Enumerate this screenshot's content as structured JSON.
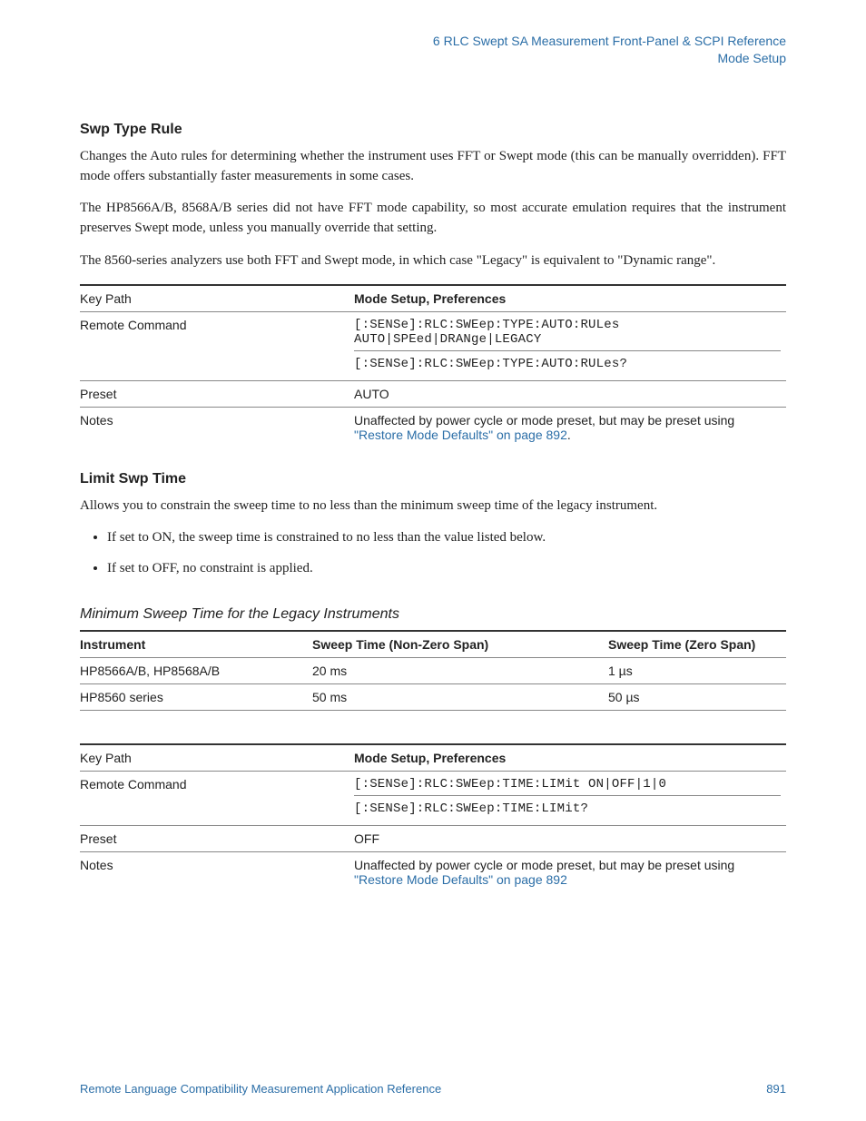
{
  "header": {
    "line1": "6  RLC Swept SA Measurement Front-Panel & SCPI Reference",
    "line2": "Mode Setup"
  },
  "sections": {
    "swpTypeRule": {
      "title": "Swp Type Rule",
      "p1": "Changes the Auto rules for determining whether the instrument uses FFT or Swept mode (this can be manually overridden). FFT mode offers substantially faster measurements in some cases.",
      "p2": "The HP8566A/B, 8568A/B series did not have FFT mode capability, so most accurate emulation requires that the instrument preserves Swept mode, unless you manually override that setting.",
      "p3": "The 8560-series analyzers use both FFT and Swept mode, in which case \"Legacy\" is equivalent to \"Dynamic range\".",
      "table": {
        "keyPath": {
          "label": "Key Path",
          "value": "Mode Setup, Preferences"
        },
        "remoteCommand": {
          "label": "Remote Command",
          "cmd1": "[:SENSe]:RLC:SWEep:TYPE:AUTO:RULes AUTO|SPEed|DRANge|LEGACY",
          "cmd2": "[:SENSe]:RLC:SWEep:TYPE:AUTO:RULes?"
        },
        "preset": {
          "label": "Preset",
          "value": "AUTO"
        },
        "notes": {
          "label": "Notes",
          "prefix": "Unaffected by power cycle or mode preset, but may be preset using ",
          "link": "\"Restore Mode Defaults\" on page 892",
          "suffix": "."
        }
      }
    },
    "limitSwpTime": {
      "title": "Limit Swp Time",
      "p1": "Allows you to constrain the sweep time to no less than the minimum sweep time of the legacy instrument.",
      "li1": "If set to ON, the sweep time is constrained to no less than the value listed below.",
      "li2": "If set to OFF, no constraint is applied.",
      "subhead": "Minimum Sweep Time for the Legacy Instruments",
      "dataTable": {
        "headers": {
          "c1": "Instrument",
          "c2": "Sweep Time (Non-Zero Span)",
          "c3": "Sweep Time (Zero Span)"
        },
        "rows": [
          {
            "c1": "HP8566A/B, HP8568A/B",
            "c2": "20 ms",
            "c3": "1 µs"
          },
          {
            "c1": "HP8560 series",
            "c2": "50 ms",
            "c3": "50 µs"
          }
        ]
      },
      "table": {
        "keyPath": {
          "label": "Key Path",
          "value": "Mode Setup, Preferences"
        },
        "remoteCommand": {
          "label": "Remote Command",
          "cmd1": "[:SENSe]:RLC:SWEep:TIME:LIMit ON|OFF|1|0",
          "cmd2": "[:SENSe]:RLC:SWEep:TIME:LIMit?"
        },
        "preset": {
          "label": "Preset",
          "value": "OFF"
        },
        "notes": {
          "label": "Notes",
          "prefix": "Unaffected by power cycle or mode preset, but may be preset using ",
          "link": "\"Restore Mode Defaults\" on page 892",
          "suffix": ""
        }
      }
    }
  },
  "footer": {
    "left": "Remote Language Compatibility Measurement Application Reference",
    "right": "891"
  }
}
